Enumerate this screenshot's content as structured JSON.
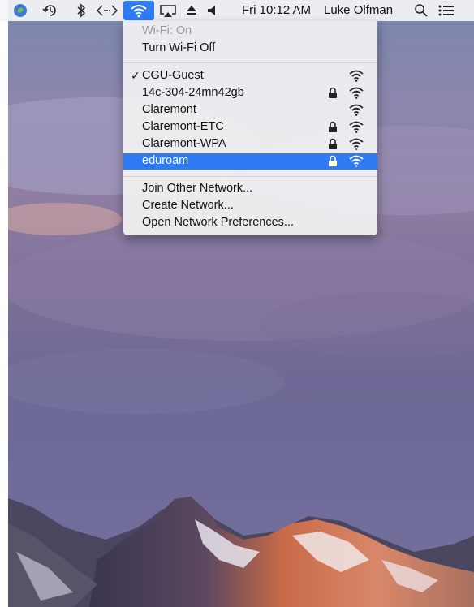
{
  "menubar": {
    "datetime": "Fri 10:12 AM",
    "user": "Luke Olfman"
  },
  "wifi_menu": {
    "status": "Wi-Fi: On",
    "toggle": "Turn Wi-Fi Off",
    "networks": [
      {
        "name": "CGU-Guest",
        "connected": true,
        "locked": false
      },
      {
        "name": "14c-304-24mn42gb",
        "connected": false,
        "locked": true
      },
      {
        "name": "Claremont",
        "connected": false,
        "locked": false
      },
      {
        "name": "Claremont-ETC",
        "connected": false,
        "locked": true
      },
      {
        "name": "Claremont-WPA",
        "connected": false,
        "locked": true
      },
      {
        "name": "eduroam",
        "connected": false,
        "locked": true,
        "highlighted": true
      }
    ],
    "checkmark": "✓",
    "join_other": "Join Other Network...",
    "create": "Create Network...",
    "preferences": "Open Network Preferences..."
  },
  "colors": {
    "highlight": "#2f7bf4",
    "menubar": "#f5f5f7"
  }
}
